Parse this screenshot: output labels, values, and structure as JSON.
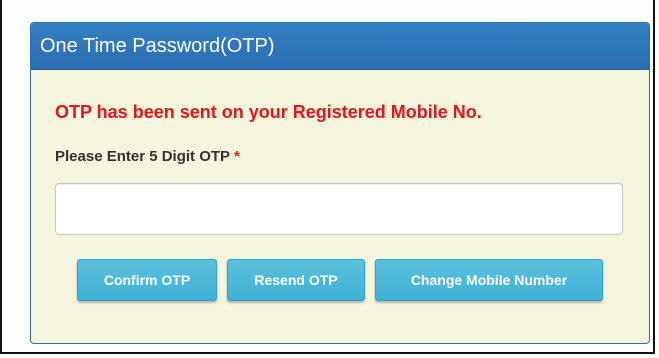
{
  "panel": {
    "title": "One Time Password(OTP)"
  },
  "message": "OTP has been sent on your Registered Mobile No.",
  "otp_field": {
    "label": "Please Enter 5 Digit OTP",
    "required_mark": "*",
    "value": "",
    "placeholder": ""
  },
  "buttons": {
    "confirm_label": "Confirm OTP",
    "resend_label": "Resend OTP",
    "change_label": "Change Mobile Number"
  },
  "colors": {
    "header_bg": "#2f78bd",
    "panel_bg": "#f5f4dc",
    "message": "#e4161b",
    "button_bg": "#4cb8da"
  }
}
